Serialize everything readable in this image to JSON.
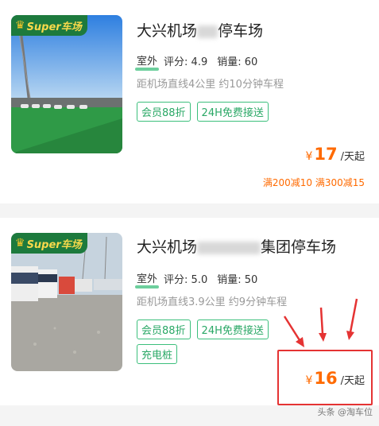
{
  "badge_label": "Super车场",
  "lots": [
    {
      "name_part1": "大兴机场",
      "name_part2": "停车场",
      "type": "室外",
      "rating_label": "评分:",
      "rating": "4.9",
      "sales_label": "销量:",
      "sales": "60",
      "distance": "距机场直线4公里 约10分钟车程",
      "tags": [
        "会员88折",
        "24H免费接送"
      ],
      "currency": "¥",
      "price": "17",
      "unit": "/天起",
      "promo": "满200减10 满300减15"
    },
    {
      "name_part1": "大兴机场",
      "name_part2": "集团停车场",
      "type": "室外",
      "rating_label": "评分:",
      "rating": "5.0",
      "sales_label": "销量:",
      "sales": "50",
      "distance": "距机场直线3.9公里 约9分钟车程",
      "tags": [
        "会员88折",
        "24H免费接送",
        "充电桩"
      ],
      "currency": "¥",
      "price": "16",
      "unit": "/天起"
    }
  ],
  "watermark": "头条 @淘车位",
  "colors": {
    "accent_green": "#3cbf7c",
    "price_orange": "#ff6a00",
    "annotation_red": "#e53333",
    "badge_green": "#1d7a3d"
  }
}
